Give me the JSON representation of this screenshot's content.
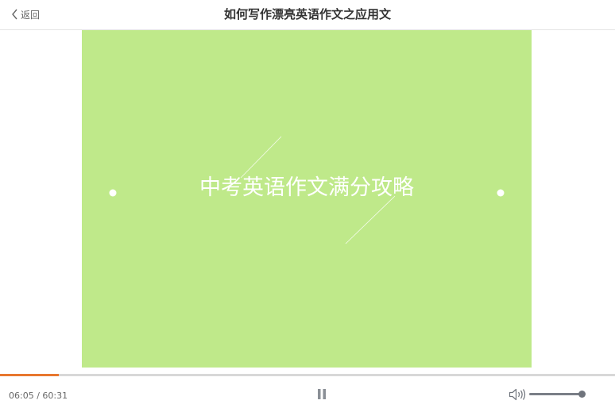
{
  "header": {
    "back_label": "返回",
    "title": "如何写作漂亮英语作文之应用文"
  },
  "video": {
    "slide_text": "中考英语作文满分攻略",
    "background_color": "#bfe98a"
  },
  "player": {
    "current_time": "06:05",
    "separator": " / ",
    "duration": "60:31",
    "progress_fraction": 0.0955,
    "state_icon": "pause-icon",
    "volume_fraction": 1.0,
    "accent_color": "#e8772e"
  }
}
